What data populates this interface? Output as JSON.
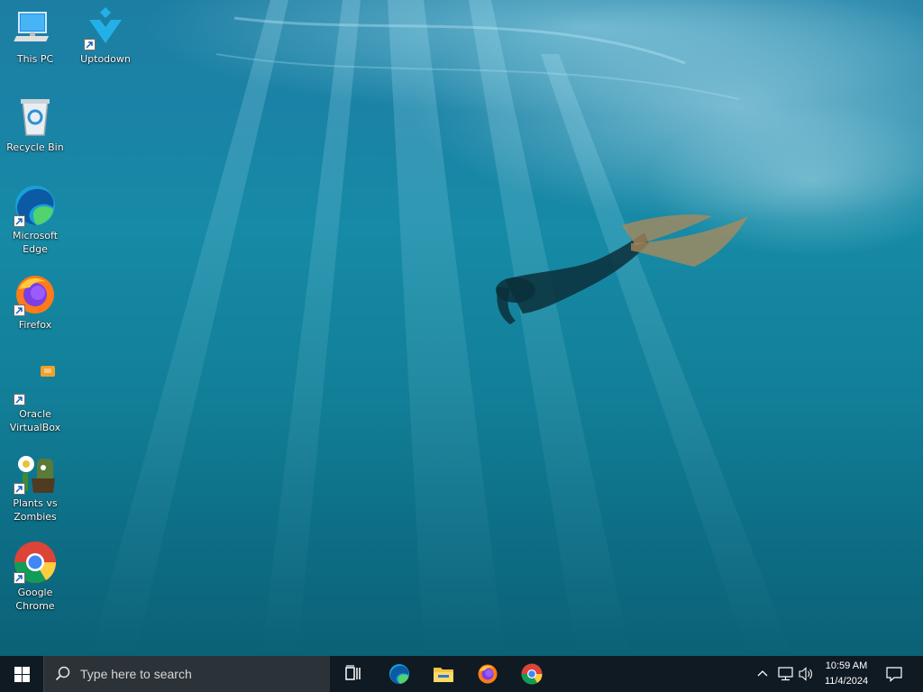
{
  "desktop": {
    "wallpaper": "underwater freediver",
    "icons": [
      {
        "label": "This PC",
        "icon": "computer-icon"
      },
      {
        "label": "Uptodown",
        "icon": "uptodown-icon"
      },
      {
        "label": "Recycle Bin",
        "icon": "recycle-bin-icon"
      },
      {
        "label": "Microsoft Edge",
        "icon": "edge-icon"
      },
      {
        "label": "Firefox",
        "icon": "firefox-icon"
      },
      {
        "label": "Oracle VirtualBox",
        "icon": "virtualbox-icon"
      },
      {
        "label": "Plants vs Zombies",
        "icon": "plants-vs-zombies-icon"
      },
      {
        "label": "Google Chrome",
        "icon": "chrome-icon"
      }
    ]
  },
  "taskbar": {
    "search_placeholder": "Type here to search",
    "pinned": [
      "task-view-icon",
      "edge-icon",
      "file-explorer-icon",
      "firefox-icon",
      "chrome-icon"
    ],
    "clock": {
      "time": "10:59 AM",
      "date": "11/4/2024"
    }
  },
  "colors": {
    "taskbar": "#101a22",
    "search_box": "#2b3238",
    "water": "#168aa6"
  }
}
